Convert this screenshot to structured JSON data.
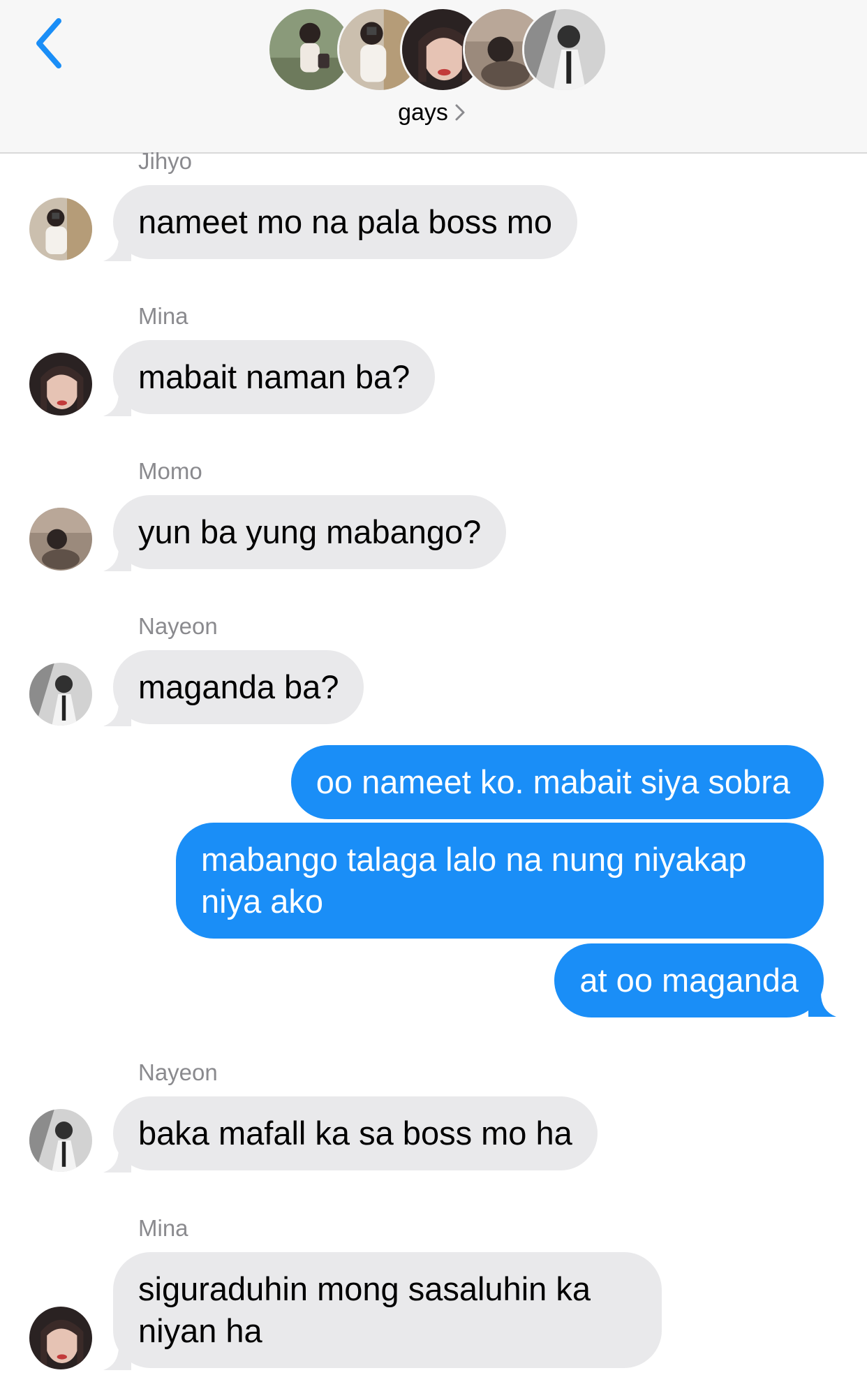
{
  "header": {
    "back_icon": "chevron-left-icon",
    "group_name": "gays",
    "chevron_icon": "chevron-right-icon",
    "accent": "#1a8ef7"
  },
  "messages": [
    {
      "sender": "Jihyo",
      "text": "nameet mo na pala boss mo"
    },
    {
      "sender": "Mina",
      "text": "mabait naman ba?"
    },
    {
      "sender": "Momo",
      "text": "yun ba yung mabango?"
    },
    {
      "sender": "Nayeon",
      "text": "maganda ba?"
    },
    {
      "text": "oo nameet ko. mabait siya sobra"
    },
    {
      "text": "mabango talaga lalo na nung niyakap niya ako"
    },
    {
      "text": "at oo maganda"
    },
    {
      "sender": "Nayeon",
      "text": "baka mafall ka sa boss mo ha"
    },
    {
      "sender": "Mina",
      "text": "siguraduhin mong sasaluhin ka niyan ha"
    }
  ],
  "colors": {
    "incoming_bubble": "#e9e9eb",
    "outgoing_bubble": "#1a8ef7",
    "sender_label": "#8a8a8e",
    "header_bg": "#f7f7f7"
  }
}
